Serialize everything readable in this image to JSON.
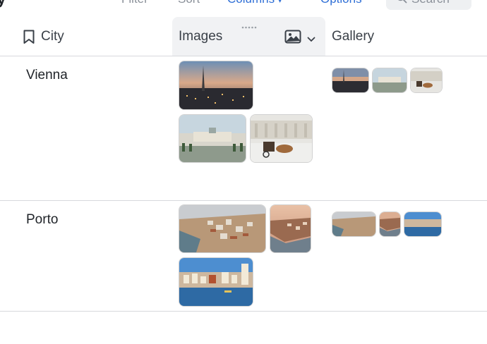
{
  "toolbar": {
    "title": "y",
    "filter_label": "Filter",
    "sort_label": "Sort",
    "columns_label": "Columns",
    "options_label": "Options",
    "search_label": "Search"
  },
  "columns": {
    "city": "City",
    "images": "Images",
    "gallery": "Gallery"
  },
  "rows": [
    {
      "city": "Vienna"
    },
    {
      "city": "Porto"
    }
  ],
  "colors": {
    "accent": "#2f6fd6",
    "muted": "#8a9099",
    "header_highlight": "#f1f2f4",
    "divider": "#d7d9dc"
  }
}
